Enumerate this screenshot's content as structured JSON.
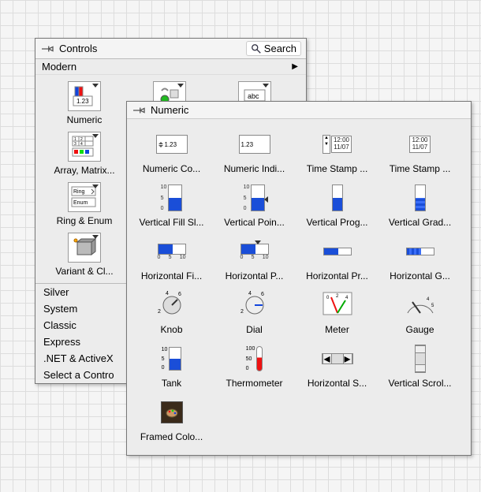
{
  "controls_panel": {
    "title": "Controls",
    "search_label": "Search",
    "active_category": "Modern",
    "top_row": [
      {
        "id": "numeric",
        "label": "Numeric"
      },
      {
        "id": "boolean",
        "label": ""
      },
      {
        "id": "string",
        "label": ""
      }
    ],
    "left_items": [
      {
        "id": "numeric",
        "label": "Numeric"
      },
      {
        "id": "array",
        "label": "Array, Matrix..."
      },
      {
        "id": "ring",
        "label": "Ring & Enum"
      },
      {
        "id": "variant",
        "label": "Variant & Cl..."
      }
    ],
    "bottom_categories": [
      "Silver",
      "System",
      "Classic",
      "Express",
      ".NET & ActiveX",
      "Select a Contro"
    ]
  },
  "numeric_panel": {
    "title": "Numeric",
    "items": [
      {
        "id": "num-control",
        "label": "Numeric Co...",
        "kind": "numctrl"
      },
      {
        "id": "num-indicator",
        "label": "Numeric Indi...",
        "kind": "numind"
      },
      {
        "id": "ts-control",
        "label": "Time Stamp ...",
        "kind": "tsctrl"
      },
      {
        "id": "ts-indicator",
        "label": "Time Stamp ...",
        "kind": "tsind"
      },
      {
        "id": "vfill",
        "label": "Vertical Fill Sl...",
        "kind": "vfill"
      },
      {
        "id": "vpoint",
        "label": "Vertical Poin...",
        "kind": "vpoint"
      },
      {
        "id": "vprog",
        "label": "Vertical Prog...",
        "kind": "vprog"
      },
      {
        "id": "vgrad",
        "label": "Vertical Grad...",
        "kind": "vgrad"
      },
      {
        "id": "hfill",
        "label": "Horizontal Fi...",
        "kind": "hfill"
      },
      {
        "id": "hpoint",
        "label": "Horizontal P...",
        "kind": "hpoint"
      },
      {
        "id": "hprog",
        "label": "Horizontal Pr...",
        "kind": "hprog"
      },
      {
        "id": "hgrad",
        "label": "Horizontal G...",
        "kind": "hgrad"
      },
      {
        "id": "knob",
        "label": "Knob",
        "kind": "knob"
      },
      {
        "id": "dial",
        "label": "Dial",
        "kind": "dial"
      },
      {
        "id": "meter",
        "label": "Meter",
        "kind": "meter"
      },
      {
        "id": "gauge",
        "label": "Gauge",
        "kind": "gauge"
      },
      {
        "id": "tank",
        "label": "Tank",
        "kind": "tank"
      },
      {
        "id": "therm",
        "label": "Thermometer",
        "kind": "therm"
      },
      {
        "id": "hscroll",
        "label": "Horizontal S...",
        "kind": "hscroll"
      },
      {
        "id": "vscroll",
        "label": "Vertical Scrol...",
        "kind": "vscroll"
      },
      {
        "id": "colorbox",
        "label": "Framed Colo...",
        "kind": "colorbox"
      }
    ],
    "sample_values": {
      "numctrl": "1.23",
      "numind": "1.23",
      "time_top": "12:00",
      "time_bot": "11/07",
      "scale_max": "10",
      "scale_mid": "5",
      "scale_min": "0",
      "therm_max": "100",
      "therm_mid": "50",
      "therm_min": "0"
    }
  }
}
